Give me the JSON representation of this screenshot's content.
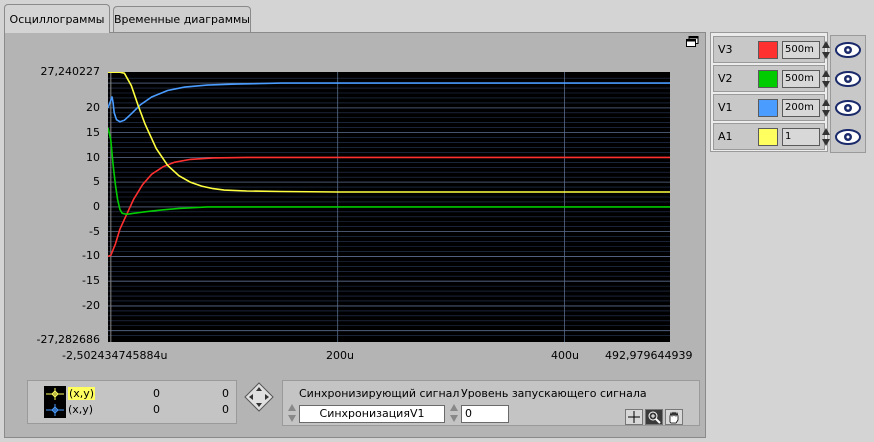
{
  "tabs": [
    {
      "label": "Осциллограммы",
      "active": true
    },
    {
      "label": "Временные диаграммы",
      "active": false
    }
  ],
  "chart_data": {
    "type": "line",
    "title": "",
    "xlabel": "",
    "ylabel": "",
    "xlim": [
      -2.502434745884,
      492.979644939
    ],
    "ylim": [
      -27.282686,
      27.240227
    ],
    "x_unit": "u",
    "x_ticks": [
      "-2,502434745884u",
      "200u",
      "400u",
      "492,979644939"
    ],
    "y_ticks": [
      "27,240227",
      "20",
      "15",
      "10",
      "5",
      "0",
      "-5",
      "-10",
      "-15",
      "-20",
      "-27,282686"
    ],
    "grid": true,
    "background": "#000000",
    "series": [
      {
        "name": "V3",
        "color": "#ff3030",
        "x": [
          -2.5,
          0,
          4,
          8,
          14,
          20,
          28,
          36,
          46,
          56,
          70,
          90,
          120,
          200,
          300,
          400,
          492.98
        ],
        "y": [
          -10,
          -9.8,
          -7.5,
          -4.5,
          -1.5,
          1.5,
          4.5,
          6.6,
          8.1,
          9.0,
          9.6,
          9.9,
          10.0,
          10.0,
          10.0,
          10.0,
          10.0
        ]
      },
      {
        "name": "V2",
        "color": "#00cc00",
        "x": [
          -2.5,
          0,
          2,
          4,
          6,
          8,
          10,
          14,
          20,
          30,
          45,
          60,
          85,
          120,
          200,
          300,
          400,
          492.98
        ],
        "y": [
          16.0,
          13.5,
          8.5,
          4.5,
          1.5,
          -0.5,
          -1.3,
          -1.5,
          -1.3,
          -1.0,
          -0.6,
          -0.3,
          0,
          0,
          0,
          0,
          0,
          0
        ]
      },
      {
        "name": "V1",
        "color": "#4a9cff",
        "x": [
          -2.5,
          0,
          1,
          2,
          3,
          5,
          8,
          12,
          18,
          26,
          36,
          50,
          65,
          85,
          110,
          150,
          200,
          300,
          400,
          492.98
        ],
        "y": [
          20.0,
          21.5,
          22.3,
          21.0,
          19.0,
          17.6,
          17.2,
          17.5,
          18.8,
          20.6,
          22.2,
          23.5,
          24.2,
          24.6,
          24.8,
          25.0,
          25.0,
          25.0,
          25.0,
          25.0
        ]
      },
      {
        "name": "A1",
        "color": "#ffff40",
        "x": [
          -2.5,
          0,
          1,
          2,
          3,
          4,
          5,
          8,
          12,
          18,
          24,
          30,
          40,
          50,
          60,
          70,
          80,
          90,
          100,
          120,
          150,
          200,
          260,
          300,
          400,
          492.98
        ],
        "y": [
          27.2,
          27.2,
          27.2,
          27.2,
          27.2,
          27.2,
          27.2,
          27.2,
          27.0,
          24.5,
          20.5,
          16.8,
          11.8,
          8.4,
          6.3,
          5.0,
          4.2,
          3.7,
          3.4,
          3.2,
          3.1,
          3.0,
          3.0,
          3.0,
          3.0,
          3.0
        ]
      }
    ]
  },
  "legend": [
    {
      "name": "V3",
      "color": "#ff3030",
      "scale": "500m"
    },
    {
      "name": "V2",
      "color": "#00cc00",
      "scale": "500m"
    },
    {
      "name": "V1",
      "color": "#4a9cff",
      "scale": "200m"
    },
    {
      "name": "A1",
      "color": "#ffff60",
      "scale": "1"
    }
  ],
  "cursors": [
    {
      "label": "(x,y)",
      "x": "0",
      "y": "0",
      "highlighted": true
    },
    {
      "label": "(x,y)",
      "x": "0",
      "y": "0",
      "highlighted": false
    }
  ],
  "trigger": {
    "sync_label": "Синхронизирующий сигнал",
    "sync_value": "СинхронизацияV1",
    "level_label": "Уровень запускающего сигнала",
    "level_value": "0"
  },
  "icons": [
    "restore-window-icon",
    "eye-icon",
    "cursor-crosshair-icon",
    "zoom-icon",
    "hand-pan-icon",
    "diamond-navigator-icon",
    "spin-arrows-icon"
  ]
}
